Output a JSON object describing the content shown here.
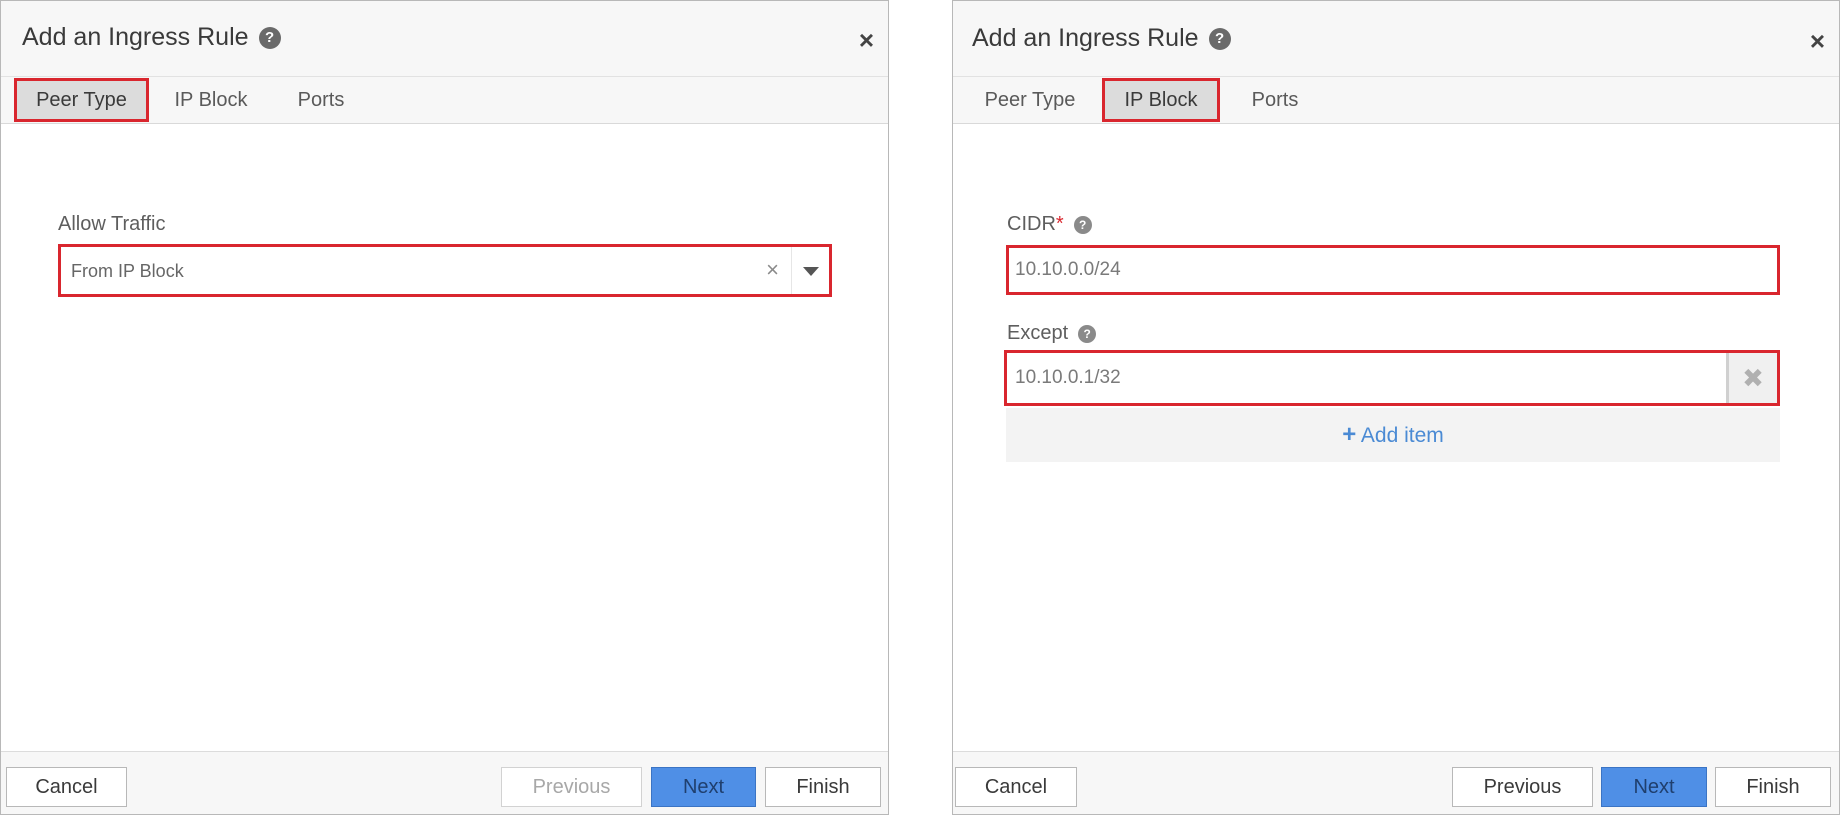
{
  "left_dialog": {
    "title": "Add an Ingress Rule",
    "help_glyph": "?",
    "close_glyph": "×",
    "tabs": [
      "Peer Type",
      "IP Block",
      "Ports"
    ],
    "active_tab": "Peer Type",
    "allow_traffic_label": "Allow Traffic",
    "allow_traffic_value": "From IP Block",
    "clear_glyph": "×",
    "buttons": {
      "cancel": "Cancel",
      "previous": "Previous",
      "next": "Next",
      "finish": "Finish"
    },
    "previous_disabled": true
  },
  "right_dialog": {
    "title": "Add an Ingress Rule",
    "help_glyph": "?",
    "close_glyph": "×",
    "tabs": [
      "Peer Type",
      "IP Block",
      "Ports"
    ],
    "active_tab": "IP Block",
    "cidr_label": "CIDR",
    "required_mark": "*",
    "cidr_value": "10.10.0.0/24",
    "except_label": "Except",
    "except_value": "10.10.0.1/32",
    "remove_glyph": "✖",
    "add_item_icon": "+",
    "add_item_label": "Add item",
    "buttons": {
      "cancel": "Cancel",
      "previous": "Previous",
      "next": "Next",
      "finish": "Finish"
    },
    "previous_disabled": false
  },
  "colors": {
    "highlight": "#d9262e",
    "primary_button": "#4f8fe6",
    "link": "#4a8ad4"
  }
}
